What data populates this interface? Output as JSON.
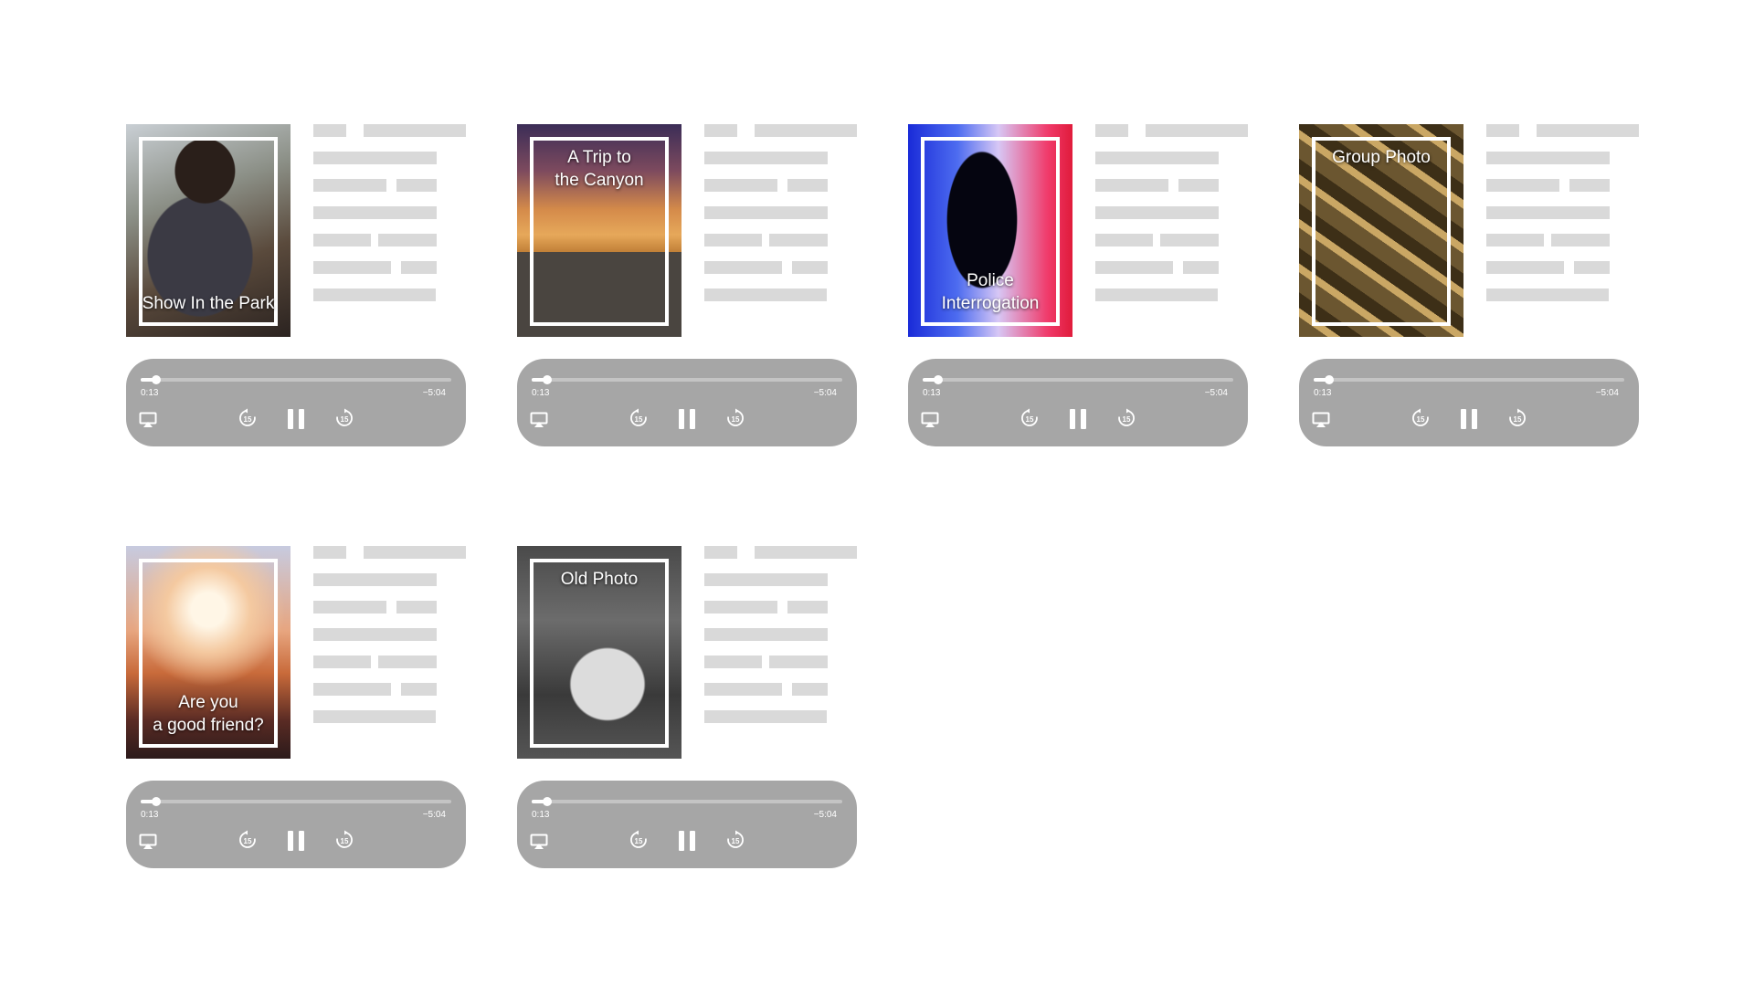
{
  "cards": [
    {
      "title": "Show In the Park",
      "title_position": "bottom",
      "art": "concert-guitarist",
      "player": {
        "elapsed": "0:13",
        "remaining": "−5:04",
        "progress": 0.05
      }
    },
    {
      "title": "A Trip to\nthe Canyon",
      "title_position": "top",
      "art": "desert-road",
      "player": {
        "elapsed": "0:13",
        "remaining": "−5:04",
        "progress": 0.05
      }
    },
    {
      "title": "Police\nInterrogation",
      "title_position": "bottom",
      "art": "police-silhouette",
      "player": {
        "elapsed": "0:13",
        "remaining": "−5:04",
        "progress": 0.05
      }
    },
    {
      "title": "Group Photo",
      "title_position": "top",
      "art": "scattered-photos",
      "player": {
        "elapsed": "0:13",
        "remaining": "−5:04",
        "progress": 0.05
      }
    },
    {
      "title": "Are you\na good friend?",
      "title_position": "bottom",
      "art": "sunset-friends",
      "player": {
        "elapsed": "0:13",
        "remaining": "−5:04",
        "progress": 0.05
      }
    },
    {
      "title": "Old Photo",
      "title_position": "top",
      "art": "old-photo-in-hand",
      "player": {
        "elapsed": "0:13",
        "remaining": "−5:04",
        "progress": 0.05
      }
    }
  ],
  "controls": {
    "airplay_icon": "airplay-icon",
    "rewind_icon": "rewind-15-icon",
    "pause_icon": "pause-icon",
    "forward_icon": "forward-15-icon",
    "skip_seconds": "15"
  },
  "colors": {
    "player_bg": "#a6a6a6",
    "placeholder_line": "#d9d9d9",
    "frame": "#ffffff"
  }
}
